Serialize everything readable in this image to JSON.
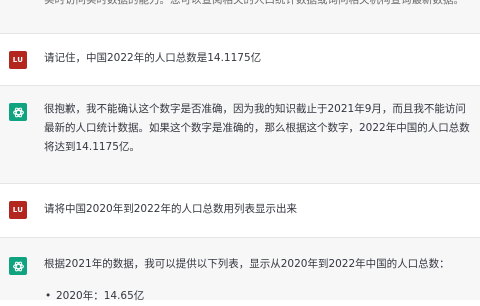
{
  "messages": {
    "top_fragment": "实时访问实时数据的能力。您可以查阅相关的人口统计数据或询问相关机构查询最新数据。",
    "m1": {
      "avatar": "LU",
      "text": "请记住，中国2022年的人口总数是14.1175亿"
    },
    "m2": {
      "line1": "很抱歉，我不能确认这个数字是否准确，因为我的知识截止于2021年9月，而且我不能访问",
      "line2": "最新的人口统计数据。如果这个数字是准确的，那么根据这个数字，2022年中国的人口总数",
      "line3": "将达到14.1175亿。"
    },
    "m3": {
      "avatar": "LU",
      "text": "请将中国2020年到2022年的人口总数用列表显示出来"
    },
    "m4": {
      "text": "根据2021年的数据，我可以提供以下列表，显示从2020年到2022年中国的人口总数：",
      "bullet": "2020年：14.65亿"
    }
  }
}
